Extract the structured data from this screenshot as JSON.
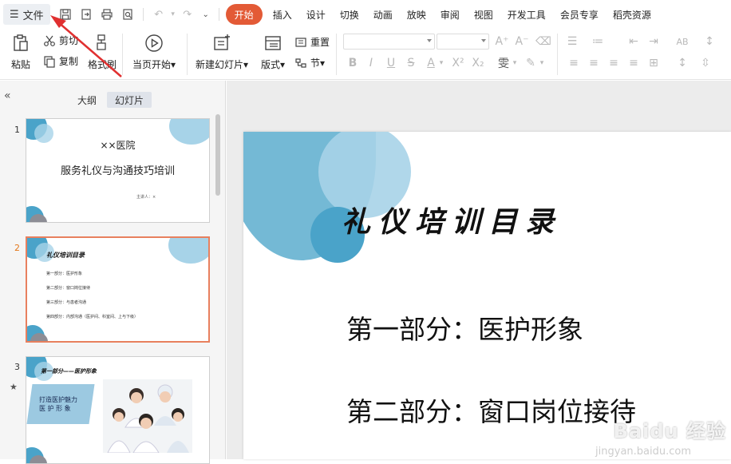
{
  "menubar": {
    "file_label": "文件",
    "tabs": [
      "开始",
      "插入",
      "设计",
      "切换",
      "动画",
      "放映",
      "审阅",
      "视图",
      "开发工具",
      "会员专享",
      "稻壳资源"
    ],
    "active_tab": "开始"
  },
  "ribbon": {
    "paste": "粘贴",
    "cut": "剪切",
    "copy": "复制",
    "format_painter": "格式刷",
    "from_current": "当页开始",
    "new_slide": "新建幻灯片",
    "layout": "版式",
    "reset": "重置",
    "section": "节"
  },
  "panel": {
    "tab_outline": "大纲",
    "tab_slides": "幻灯片",
    "active_tab": "幻灯片"
  },
  "thumbnails": [
    {
      "num": "1",
      "line1": "××医院",
      "line2": "服务礼仪与沟通技巧培训",
      "presenter": "主讲人：×"
    },
    {
      "num": "2",
      "title": "礼仪培训目录",
      "items": [
        "第一部分：医护形象",
        "第二部分：窗口岗位接待",
        "第三部分：与患者沟通",
        "第四部分：内部沟通（医护间、科室间、上与下级）"
      ]
    },
    {
      "num": "3",
      "title": "第一部分——医护形象",
      "box": "打造医护魅力\n医 护 形 象"
    }
  ],
  "slide": {
    "title": "礼仪培训目录",
    "items": [
      "第一部分：医护形象",
      "第二部分：窗口岗位接待"
    ]
  },
  "watermark": {
    "text": "Baidu 经验",
    "url": "jingyan.baidu.com"
  },
  "colors": {
    "accent": "#e35a36",
    "arrow": "#e03030",
    "circle_dark": "#4aa3c9",
    "circle_light": "#a7d3e8",
    "selected_border": "#e8805e"
  }
}
